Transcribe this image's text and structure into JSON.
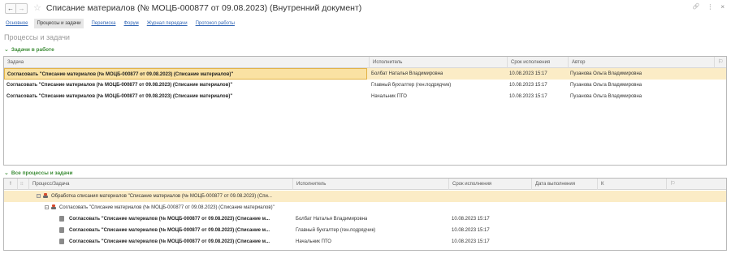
{
  "window": {
    "title": "Списание материалов (№ МОЦБ-000877 от 09.08.2023) (Внутренний документ)",
    "back": "←",
    "forward": "→",
    "star": "☆",
    "link_icon": "🔗",
    "menu_icon": "⋮",
    "close_icon": "×"
  },
  "tabs": [
    {
      "label": "Основное"
    },
    {
      "label": "Процессы и задачи"
    },
    {
      "label": "Переписка"
    },
    {
      "label": "Форум"
    },
    {
      "label": "Журнал передачи"
    },
    {
      "label": "Протокол работы"
    }
  ],
  "page_heading": "Процессы и задачи",
  "tasks_section": {
    "title": "Задачи в работе",
    "columns": [
      "Задача",
      "Исполнитель",
      "Срок исполнения",
      "Автор"
    ],
    "rows": [
      {
        "task": "Согласовать \"Списание материалов (№ МОЦБ-000877 от 09.08.2023) (Списание материалов)\"",
        "executor": "Болбат Наталья Владимировна",
        "due": "10.08.2023 15:17",
        "author": "Пузанова Ольга Владимировна"
      },
      {
        "task": "Согласовать \"Списание материалов (№ МОЦБ-000877 от 09.08.2023) (Списание материалов)\"",
        "executor": "Главный бухгалтер (ген.подрядчик)",
        "due": "10.08.2023 15:17",
        "author": "Пузанова Ольга Владимировна"
      },
      {
        "task": "Согласовать \"Списание материалов (№ МОЦБ-000877 от 09.08.2023) (Списание материалов)\"",
        "executor": "Начальник ПТО",
        "due": "10.08.2023 15:17",
        "author": "Пузанова Ольга Владимировна"
      }
    ]
  },
  "all_section": {
    "title": "Все процессы и задачи",
    "columns": [
      "!",
      "Процесс/Задача",
      "Исполнитель",
      "Срок исполнения",
      "Дата выполнения",
      "К"
    ],
    "process_row": "Обработка списания материалов \"Списание материалов (№ МОЦБ-000877 от 09.08.2023) (Спи...",
    "subprocess_row": "Согласовать \"Списание материалов (№ МОЦБ-000877 от 09.08.2023) (Списание материалов)\"",
    "task_rows": [
      {
        "task": "Согласовать \"Списание материалов (№ МОЦБ-000877 от 09.08.2023) (Списание м...",
        "executor": "Болбат Наталья Владимировна",
        "due": "10.08.2023 15:17"
      },
      {
        "task": "Согласовать \"Списание материалов (№ МОЦБ-000877 от 09.08.2023) (Списание м...",
        "executor": "Главный бухгалтер (ген.подрядчик)",
        "due": "10.08.2023 15:17"
      },
      {
        "task": "Согласовать \"Списание материалов (№ МОЦБ-000877 от 09.08.2023) (Списание м...",
        "executor": "Начальник ПТО",
        "due": "10.08.2023 15:17"
      }
    ]
  },
  "colors": {
    "accent_green": "#3c8c36",
    "link_blue": "#3367b5",
    "selection": "#fbecc6"
  }
}
